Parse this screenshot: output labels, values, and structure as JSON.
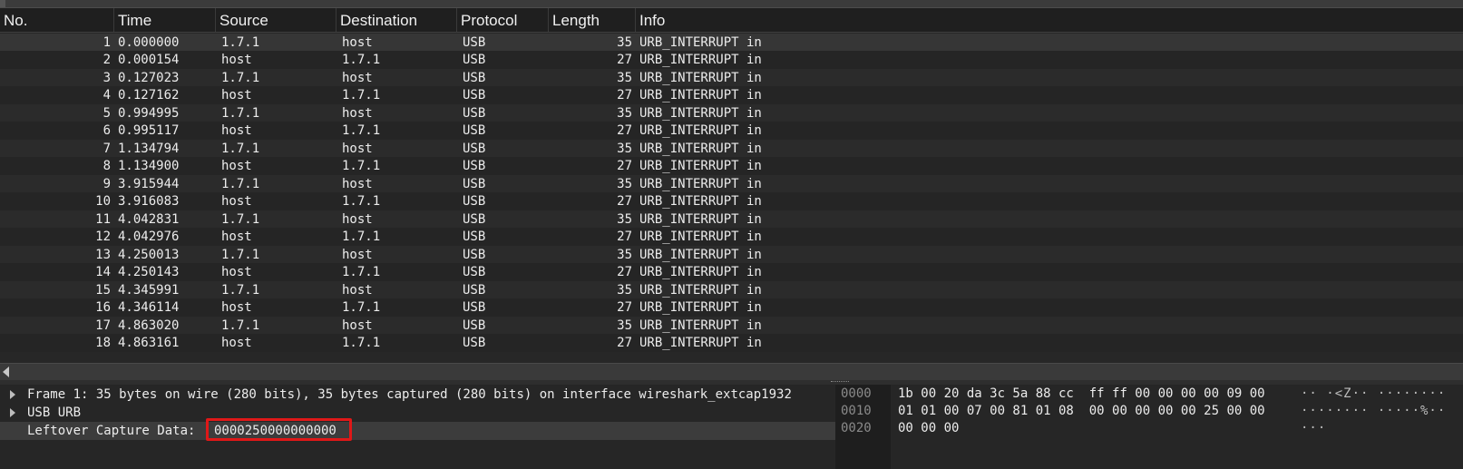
{
  "columns": {
    "no": "No.",
    "time": "Time",
    "source": "Source",
    "destination": "Destination",
    "protocol": "Protocol",
    "length": "Length",
    "info": "Info"
  },
  "packets": [
    {
      "no": "1",
      "time": "0.000000",
      "source": "1.7.1",
      "destination": "host",
      "protocol": "USB",
      "length": "35",
      "info": "URB_INTERRUPT in"
    },
    {
      "no": "2",
      "time": "0.000154",
      "source": "host",
      "destination": "1.7.1",
      "protocol": "USB",
      "length": "27",
      "info": "URB_INTERRUPT in"
    },
    {
      "no": "3",
      "time": "0.127023",
      "source": "1.7.1",
      "destination": "host",
      "protocol": "USB",
      "length": "35",
      "info": "URB_INTERRUPT in"
    },
    {
      "no": "4",
      "time": "0.127162",
      "source": "host",
      "destination": "1.7.1",
      "protocol": "USB",
      "length": "27",
      "info": "URB_INTERRUPT in"
    },
    {
      "no": "5",
      "time": "0.994995",
      "source": "1.7.1",
      "destination": "host",
      "protocol": "USB",
      "length": "35",
      "info": "URB_INTERRUPT in"
    },
    {
      "no": "6",
      "time": "0.995117",
      "source": "host",
      "destination": "1.7.1",
      "protocol": "USB",
      "length": "27",
      "info": "URB_INTERRUPT in"
    },
    {
      "no": "7",
      "time": "1.134794",
      "source": "1.7.1",
      "destination": "host",
      "protocol": "USB",
      "length": "35",
      "info": "URB_INTERRUPT in"
    },
    {
      "no": "8",
      "time": "1.134900",
      "source": "host",
      "destination": "1.7.1",
      "protocol": "USB",
      "length": "27",
      "info": "URB_INTERRUPT in"
    },
    {
      "no": "9",
      "time": "3.915944",
      "source": "1.7.1",
      "destination": "host",
      "protocol": "USB",
      "length": "35",
      "info": "URB_INTERRUPT in"
    },
    {
      "no": "10",
      "time": "3.916083",
      "source": "host",
      "destination": "1.7.1",
      "protocol": "USB",
      "length": "27",
      "info": "URB_INTERRUPT in"
    },
    {
      "no": "11",
      "time": "4.042831",
      "source": "1.7.1",
      "destination": "host",
      "protocol": "USB",
      "length": "35",
      "info": "URB_INTERRUPT in"
    },
    {
      "no": "12",
      "time": "4.042976",
      "source": "host",
      "destination": "1.7.1",
      "protocol": "USB",
      "length": "27",
      "info": "URB_INTERRUPT in"
    },
    {
      "no": "13",
      "time": "4.250013",
      "source": "1.7.1",
      "destination": "host",
      "protocol": "USB",
      "length": "35",
      "info": "URB_INTERRUPT in"
    },
    {
      "no": "14",
      "time": "4.250143",
      "source": "host",
      "destination": "1.7.1",
      "protocol": "USB",
      "length": "27",
      "info": "URB_INTERRUPT in"
    },
    {
      "no": "15",
      "time": "4.345991",
      "source": "1.7.1",
      "destination": "host",
      "protocol": "USB",
      "length": "35",
      "info": "URB_INTERRUPT in"
    },
    {
      "no": "16",
      "time": "4.346114",
      "source": "host",
      "destination": "1.7.1",
      "protocol": "USB",
      "length": "27",
      "info": "URB_INTERRUPT in"
    },
    {
      "no": "17",
      "time": "4.863020",
      "source": "1.7.1",
      "destination": "host",
      "protocol": "USB",
      "length": "35",
      "info": "URB_INTERRUPT in"
    },
    {
      "no": "18",
      "time": "4.863161",
      "source": "host",
      "destination": "1.7.1",
      "protocol": "USB",
      "length": "27",
      "info": "URB_INTERRUPT in"
    }
  ],
  "selected_packet": "1",
  "details": {
    "frame": "Frame 1: 35 bytes on wire (280 bits), 35 bytes captured (280 bits) on interface wireshark_extcap1932",
    "usb_urb": "USB URB",
    "leftover_label": "Leftover Capture Data:",
    "leftover_value": "0000250000000000"
  },
  "hex_dump": [
    {
      "offset": "0000",
      "bytes_a": "1b 00 20 da 3c 5a 88 cc",
      "bytes_b": "ff ff 00 00 00 00 09 00",
      "ascii": "·· ·<Z·· ········"
    },
    {
      "offset": "0010",
      "bytes_a": "01 01 00 07 00 81 01 08",
      "bytes_b": "00 00 00 00 00 25 00 00",
      "ascii": "········ ·····%··"
    },
    {
      "offset": "0020",
      "bytes_a": "00 00 00",
      "bytes_b": "",
      "ascii": "···"
    }
  ],
  "colors": {
    "background": "#272727",
    "highlight_box": "#e01818"
  }
}
